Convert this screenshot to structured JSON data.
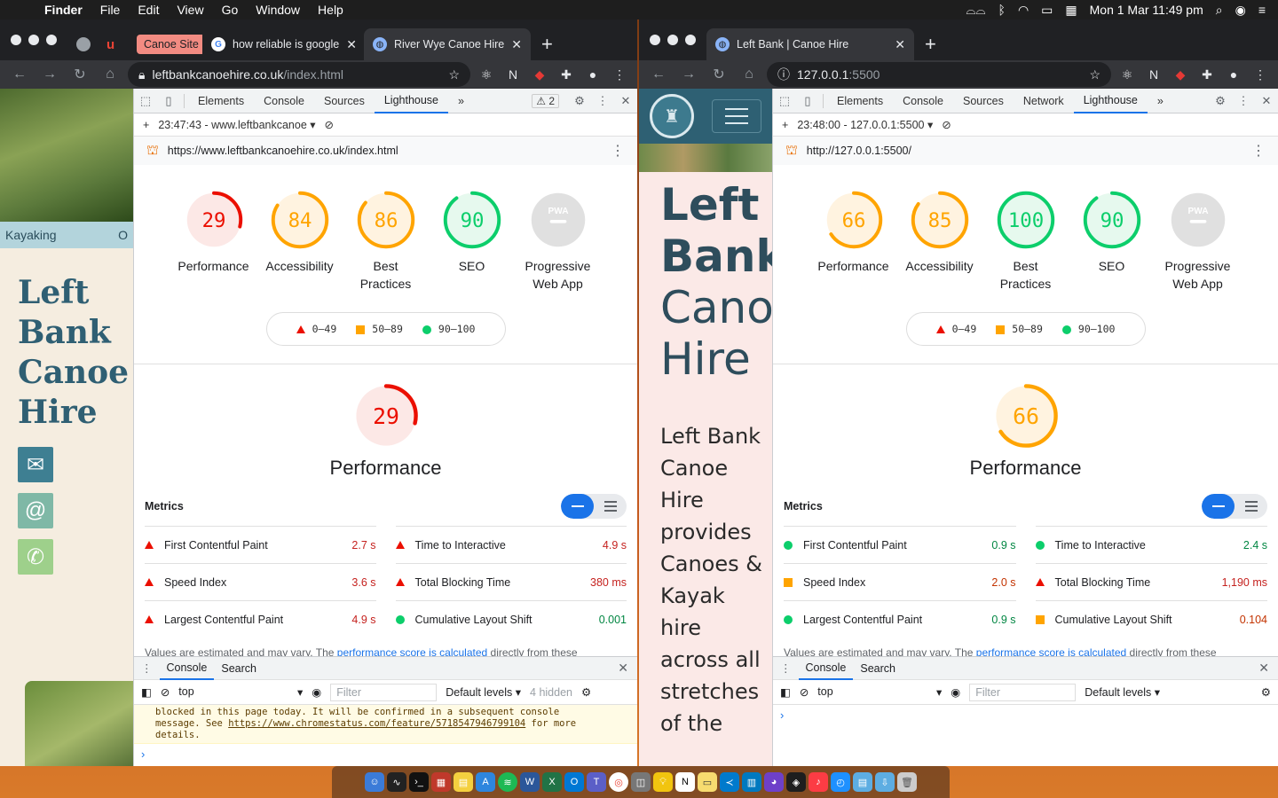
{
  "menubar": {
    "app": "Finder",
    "items": [
      "File",
      "Edit",
      "View",
      "Go",
      "Window",
      "Help"
    ],
    "clock": "Mon 1 Mar  11:49 pm"
  },
  "left": {
    "tabs": [
      {
        "label": "Canoe Site",
        "type": "chip"
      },
      {
        "label": "how reliable is google",
        "icon": "G"
      },
      {
        "label": "River Wye Canoe Hire",
        "icon": "globe",
        "active": true
      }
    ],
    "url_host": "leftbankcanoehire.co.uk",
    "url_path": "/index.html",
    "page": {
      "nav": [
        "Kayaking",
        "O"
      ],
      "title": "Left Bank Canoe Hire"
    },
    "devtools": {
      "tabs": [
        "Elements",
        "Console",
        "Sources",
        "Lighthouse"
      ],
      "active_tab": "Lighthouse",
      "more": "»",
      "warn_count": "2",
      "report_select": "23:47:43 - www.leftbankcanoe",
      "report_url": "https://www.leftbankcanoehire.co.uk/index.html",
      "scores": [
        {
          "label": "Performance",
          "value": 29
        },
        {
          "label": "Accessibility",
          "value": 84
        },
        {
          "label": "Best Practices",
          "value": 86
        },
        {
          "label": "SEO",
          "value": 90
        },
        {
          "label": "Progressive Web App",
          "value": null,
          "pwa": "PWA"
        }
      ],
      "legend": [
        "0–49",
        "50–89",
        "90–100"
      ],
      "perf_score": 29,
      "perf_label": "Performance",
      "metrics_title": "Metrics",
      "metrics": [
        {
          "name": "First Contentful Paint",
          "value": "2.7 s",
          "rating": "fail"
        },
        {
          "name": "Time to Interactive",
          "value": "4.9 s",
          "rating": "fail"
        },
        {
          "name": "Speed Index",
          "value": "3.6 s",
          "rating": "fail"
        },
        {
          "name": "Total Blocking Time",
          "value": "380 ms",
          "rating": "fail"
        },
        {
          "name": "Largest Contentful Paint",
          "value": "4.9 s",
          "rating": "fail"
        },
        {
          "name": "Cumulative Layout Shift",
          "value": "0.001",
          "rating": "pass"
        }
      ],
      "note_pre": "Values are estimated and may vary. The ",
      "note_link": "performance score is calculated",
      "note_post": " directly from these",
      "console": {
        "tabs": [
          "Console",
          "Search"
        ],
        "context": "top",
        "filter_placeholder": "Filter",
        "levels": "Default levels ▾",
        "hidden": "4 hidden",
        "msg1": "blocked in this page today. It will be confirmed in a subsequent console",
        "msg2": "message. See ",
        "msg_link": "https://www.chromestatus.com/feature/5718547946799104",
        "msg3": " for more",
        "msg4": "details."
      }
    }
  },
  "right": {
    "tabs": [
      {
        "label": "Left Bank | Canoe Hire",
        "icon": "globe",
        "active": true
      }
    ],
    "url_host": "127.0.0.1",
    "url_path": ":5500",
    "page": {
      "title_bold_1": "Left",
      "title_bold_2": "Bank",
      "title_light_1": "Cano",
      "title_light_2": "Hire",
      "para": "Left Bank Canoe Hire provides Canoes & Kayak hire across all stretches of the"
    },
    "devtools": {
      "tabs": [
        "Elements",
        "Console",
        "Sources",
        "Network",
        "Lighthouse"
      ],
      "active_tab": "Lighthouse",
      "more": "»",
      "report_select": "23:48:00 - 127.0.0.1:5500",
      "report_url": "http://127.0.0.1:5500/",
      "scores": [
        {
          "label": "Performance",
          "value": 66
        },
        {
          "label": "Accessibility",
          "value": 85
        },
        {
          "label": "Best Practices",
          "value": 100
        },
        {
          "label": "SEO",
          "value": 90
        },
        {
          "label": "Progressive Web App",
          "value": null,
          "pwa": "PWA"
        }
      ],
      "legend": [
        "0–49",
        "50–89",
        "90–100"
      ],
      "perf_score": 66,
      "perf_label": "Performance",
      "metrics_title": "Metrics",
      "metrics": [
        {
          "name": "First Contentful Paint",
          "value": "0.9 s",
          "rating": "pass"
        },
        {
          "name": "Time to Interactive",
          "value": "2.4 s",
          "rating": "pass"
        },
        {
          "name": "Speed Index",
          "value": "2.0 s",
          "rating": "average"
        },
        {
          "name": "Total Blocking Time",
          "value": "1,190 ms",
          "rating": "fail"
        },
        {
          "name": "Largest Contentful Paint",
          "value": "0.9 s",
          "rating": "pass"
        },
        {
          "name": "Cumulative Layout Shift",
          "value": "0.104",
          "rating": "average"
        }
      ],
      "note_pre": "Values are estimated and may vary. The ",
      "note_link": "performance score is calculated",
      "note_post": " directly from these",
      "console": {
        "tabs": [
          "Console",
          "Search"
        ],
        "context": "top",
        "filter_placeholder": "Filter",
        "levels": "Default levels ▾"
      }
    }
  },
  "colors": {
    "fail": "#eb0f00",
    "average": "#ffa400",
    "pass": "#0cce6b",
    "gray": "#9aa0a6"
  }
}
